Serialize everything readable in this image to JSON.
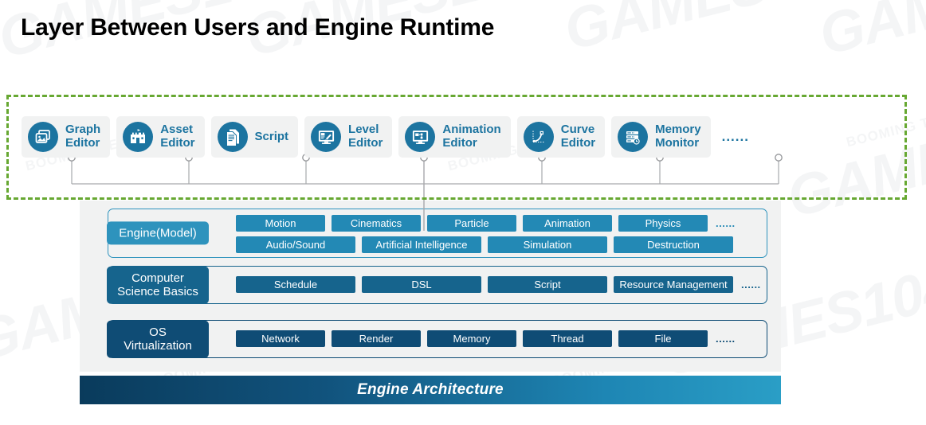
{
  "slide": {
    "title": "Layer Between Users and Engine Runtime",
    "watermark_text": "GAMES104",
    "watermark_text_small": "BOOMING TECH"
  },
  "colors": {
    "dashed_border_green": "#67a832",
    "editor_accent": "#1c74a0",
    "editor_card_bg": "#f1f2f2",
    "engine_layer": "#2389b5",
    "cs_layer": "#16648d",
    "os_layer": "#0f4c75",
    "banner_gradient_start": "#0a3b5c",
    "banner_gradient_end": "#2a9ec6"
  },
  "editors_panel": {
    "ellipsis": "......",
    "cards": [
      {
        "label": "Graph\nEditor",
        "icon": "image-gallery-icon"
      },
      {
        "label": "Asset\nEditor",
        "icon": "castle-icon"
      },
      {
        "label": "Script",
        "icon": "document-icon"
      },
      {
        "label": "Level\nEditor",
        "icon": "level-design-monitor-icon"
      },
      {
        "label": "Animation\nEditor",
        "icon": "animation-monitor-icon"
      },
      {
        "label": "Curve\nEditor",
        "icon": "bezier-curve-icon"
      },
      {
        "label": "Memory\nMonitor",
        "icon": "server-clock-icon"
      }
    ]
  },
  "architecture": {
    "rows": [
      {
        "tag": "Engine(Model)",
        "dots": "......",
        "lines": [
          [
            {
              "label": "Motion",
              "width": 112
            },
            {
              "label": "Cinematics",
              "width": 112
            },
            {
              "label": "Particle",
              "width": 112
            },
            {
              "label": "Animation",
              "width": 112
            },
            {
              "label": "Physics",
              "width": 112
            }
          ],
          [
            {
              "label": "Audio/Sound",
              "width": 150
            },
            {
              "label": "Artificial Intelligence",
              "width": 150
            },
            {
              "label": "Simulation",
              "width": 150
            },
            {
              "label": "Destruction",
              "width": 150
            }
          ]
        ]
      },
      {
        "tag": "Computer\nScience Basics",
        "dots": "......",
        "lines": [
          [
            {
              "label": "Schedule",
              "width": 150
            },
            {
              "label": "DSL",
              "width": 150
            },
            {
              "label": "Script",
              "width": 150
            },
            {
              "label": "Resource Management",
              "width": 150
            }
          ]
        ]
      },
      {
        "tag": "OS\nVirtualization",
        "dots": "......",
        "lines": [
          [
            {
              "label": "Network",
              "width": 112
            },
            {
              "label": "Render",
              "width": 112
            },
            {
              "label": "Memory",
              "width": 112
            },
            {
              "label": "Thread",
              "width": 112
            },
            {
              "label": "File",
              "width": 112
            }
          ]
        ]
      }
    ]
  },
  "banner": {
    "label": "Engine Architecture"
  }
}
